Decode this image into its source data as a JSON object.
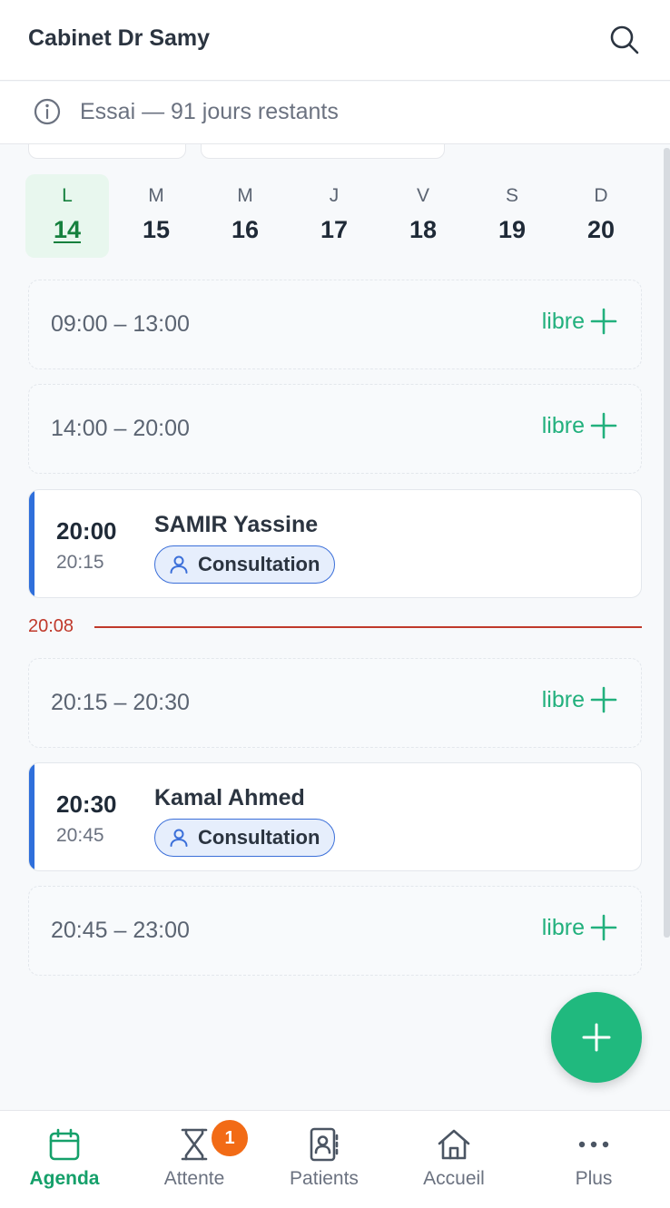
{
  "header": {
    "title": "Cabinet Dr Samy"
  },
  "trial": {
    "text": "Essai — 91 jours restants"
  },
  "week": [
    {
      "letter": "L",
      "num": "14",
      "active": true
    },
    {
      "letter": "M",
      "num": "15"
    },
    {
      "letter": "M",
      "num": "16"
    },
    {
      "letter": "J",
      "num": "17"
    },
    {
      "letter": "V",
      "num": "18"
    },
    {
      "letter": "S",
      "num": "19"
    },
    {
      "letter": "D",
      "num": "20"
    }
  ],
  "slots": [
    {
      "range": "09:00 – 13:00",
      "label": "libre"
    },
    {
      "range": "14:00 – 20:00",
      "label": "libre"
    },
    {
      "range": "20:15 – 20:30",
      "label": "libre"
    },
    {
      "range": "20:45 – 23:00",
      "label": "libre"
    }
  ],
  "appointments": [
    {
      "start": "20:00",
      "end": "20:15",
      "name": "SAMIR Yassine",
      "type": "Consultation"
    },
    {
      "start": "20:30",
      "end": "20:45",
      "name": "Kamal Ahmed",
      "type": "Consultation"
    }
  ],
  "now_time": "20:08",
  "nav": {
    "agenda": "Agenda",
    "attente": "Attente",
    "attente_badge": "1",
    "patients": "Patients",
    "accueil": "Accueil",
    "plus": "Plus"
  },
  "colors": {
    "accent": "#20b97e",
    "appointment": "#2f6fdb",
    "now": "#c0392b",
    "badge": "#f26b16"
  }
}
